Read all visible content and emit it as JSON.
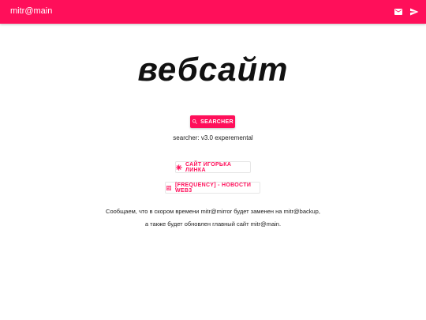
{
  "header": {
    "brand": "mitr@main",
    "icons": [
      "mail-icon",
      "send-icon"
    ]
  },
  "hero": {
    "title": "вебсайт"
  },
  "search_button": {
    "label": "SEARCHER",
    "icon": "search-icon"
  },
  "version_text": "searcher: v3.0 experemental",
  "links": [
    {
      "label": "САЙТ ИГОРЬКА ЛИНКА",
      "icon": "asterisk-icon"
    },
    {
      "label": "[FREQUENCY] - НОВОСТИ WEB3",
      "icon": "news-icon"
    }
  ],
  "notice": {
    "line1": "Сообщаем, что в скором времени mitr@mirror будет заменен на mitr@backup,",
    "line2": "а также будет обновлен главный сайт mitr@main."
  },
  "colors": {
    "accent": "#ff0f5a",
    "background": "#ffffff",
    "text": "#222222"
  }
}
